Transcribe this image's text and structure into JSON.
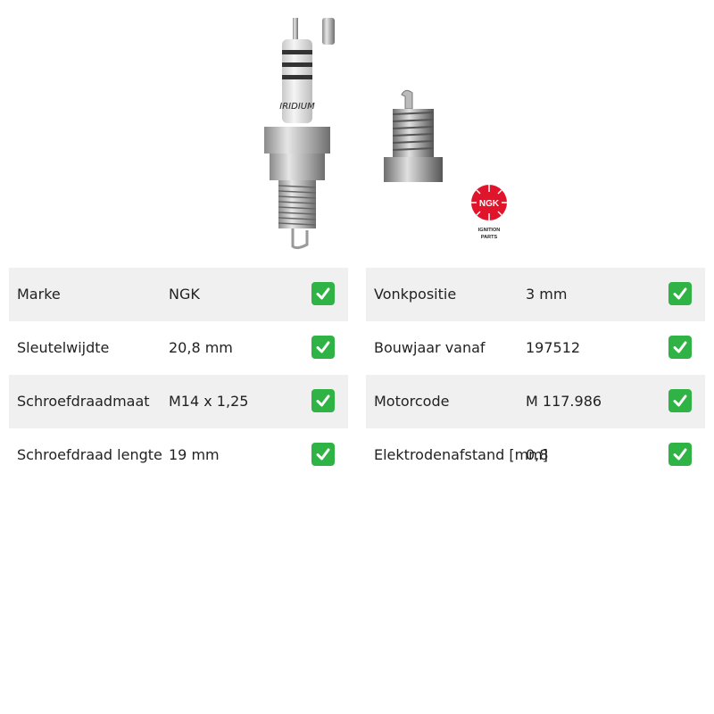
{
  "logo": {
    "brand": "NGK",
    "subtitle_line1": "IGNITION",
    "subtitle_line2": "PARTS"
  },
  "check_color": "#2fb344",
  "check_icon": "check-mark-icon",
  "left_specs": [
    {
      "label": "Marke",
      "value": "NGK"
    },
    {
      "label": "Sleutelwijdte",
      "value": "20,8 mm"
    },
    {
      "label": "Schroefdraadmaat",
      "value": "M14 x 1,25"
    },
    {
      "label": "Schroefdraad lengte",
      "value": "19 mm"
    }
  ],
  "right_specs": [
    {
      "label": "Vonkpositie",
      "value": "3 mm"
    },
    {
      "label": "Bouwjaar vanaf",
      "value": "197512"
    },
    {
      "label": "Motorcode",
      "value": "M 117.986"
    },
    {
      "label": "Elektrodenafstand [mm]",
      "value": "0,8"
    }
  ]
}
